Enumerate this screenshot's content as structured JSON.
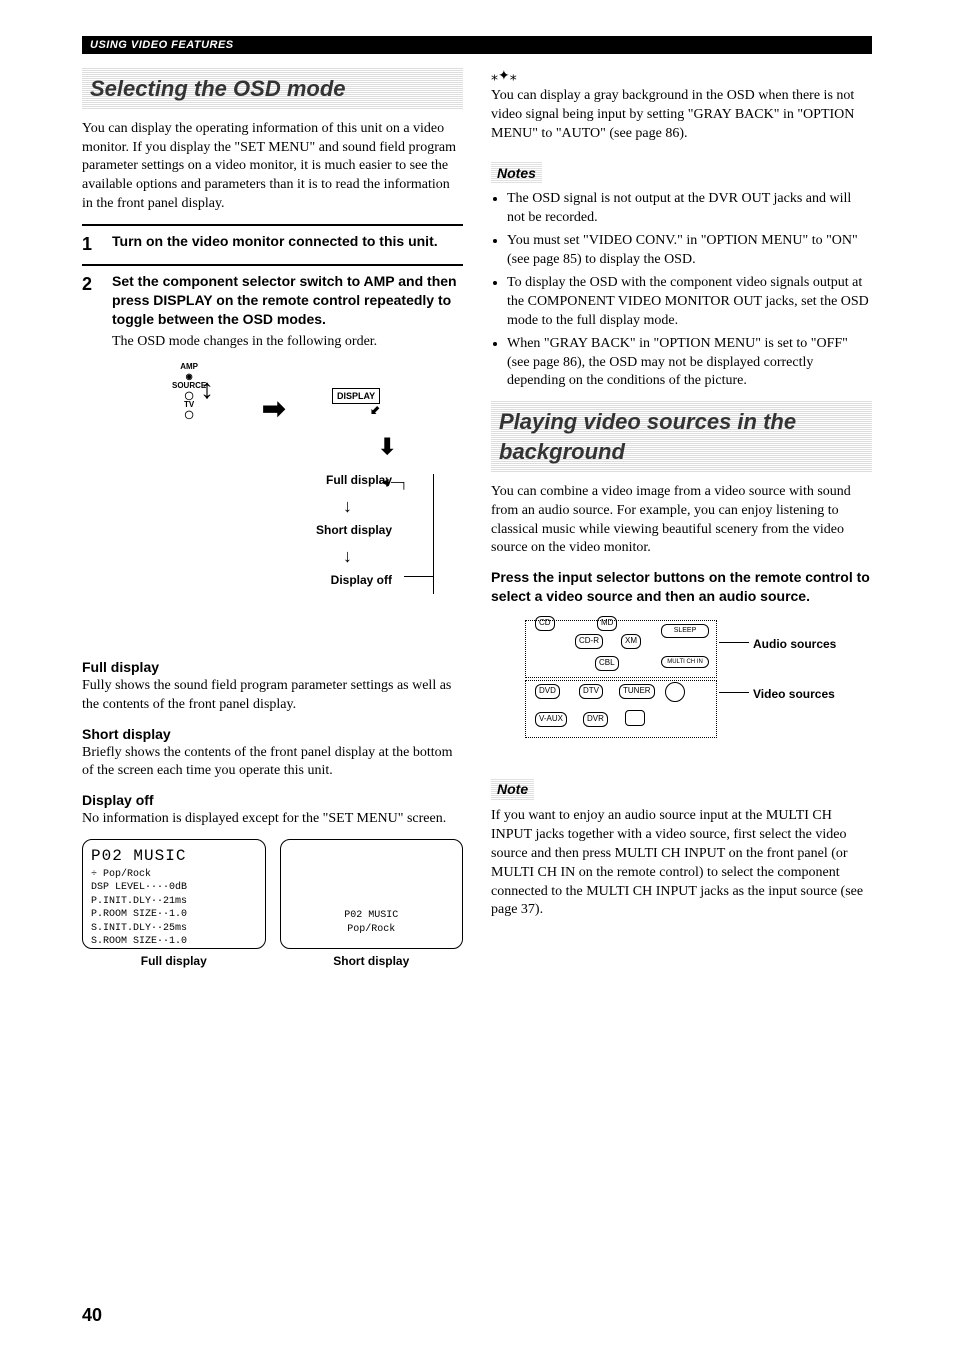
{
  "header": "USING VIDEO FEATURES",
  "pageNumber": "40",
  "left": {
    "sectionTitle": "Selecting the OSD mode",
    "intro": "You can display the operating information of this unit on a video monitor. If you display the \"SET MENU\" and sound field program parameter settings on a video monitor, it is much easier to see the available options and parameters than it is to read the information in the front panel display.",
    "step1": {
      "num": "1",
      "head": "Turn on the video monitor connected to this unit."
    },
    "step2": {
      "num": "2",
      "head": "Set the component selector switch to AMP and then press DISPLAY on the remote control repeatedly to toggle between the OSD modes.",
      "sub": "The OSD mode changes in the following order."
    },
    "diagram": {
      "amp": "AMP",
      "source": "SOURCE",
      "tv": "TV",
      "display": "DISPLAY",
      "full": "Full display",
      "short": "Short display",
      "off": "Display off"
    },
    "fullH": "Full display",
    "fullP": "Fully shows the sound field program parameter settings as well as the contents of the front panel display.",
    "shortH": "Short display",
    "shortP": "Briefly shows the contents of the front panel display at the bottom of the screen each time you operate this unit.",
    "offH": "Display off",
    "offP": "No information is displayed except for the \"SET MENU\" screen.",
    "screen1": {
      "line1": "P02      MUSIC",
      "line2": "÷       Pop/Rock",
      "line3": "    DSP LEVEL····0dB",
      "line4": "    P.INIT.DLY··21ms",
      "line5": "    P.ROOM SIZE··1.0",
      "line6": "    S.INIT.DLY··25ms",
      "line7": "    S.ROOM SIZE··1.0",
      "cap": "Full display"
    },
    "screen2": {
      "line1": "P02      MUSIC",
      "line2": "         Pop/Rock",
      "cap": "Short display"
    }
  },
  "right": {
    "tipP": "You can display a gray background in the OSD when there is not video signal being input by setting \"GRAY BACK\" in \"OPTION MENU\" to \"AUTO\" (see page 86).",
    "notesLabel": "Notes",
    "notes": [
      "The OSD signal is not output at the DVR OUT jacks and will not be recorded.",
      "You must set \"VIDEO CONV.\" in \"OPTION MENU\" to \"ON\" (see page 85) to display the OSD.",
      "To display the OSD with the component video signals output at the COMPONENT VIDEO MONITOR OUT jacks, set the OSD mode to the full display mode.",
      "When \"GRAY BACK\" in \"OPTION MENU\" is set to \"OFF\" (see page 86), the OSD may not be displayed correctly depending on the conditions of the picture."
    ],
    "sectionTitle": "Playing video sources in the background",
    "intro2": "You can combine a video image from a video source with sound from an audio source. For example, you can enjoy listening to classical music while viewing beautiful scenery from the video source on the video monitor.",
    "instr": "Press the input selector buttons on the remote control to select a video source and then an audio source.",
    "diagram": {
      "md": "MD",
      "cdr": "CD-R",
      "xm": "XM",
      "sleep": "SLEEP",
      "cd": "CD",
      "cbl": "CBL",
      "multichin": "MULTI CH IN",
      "dvd": "DVD",
      "dtv": "DTV",
      "tuner": "TUNER",
      "vaux": "V-AUX",
      "dvr": "DVR",
      "audio": "Audio sources",
      "video": "Video sources"
    },
    "noteLabel": "Note",
    "noteP": "If you want to enjoy an audio source input at the MULTI CH INPUT jacks together with a video source, first select the video source and then press MULTI CH INPUT on the front panel (or MULTI CH IN on the remote control) to select the component connected to the MULTI CH INPUT jacks as the input source (see page 37)."
  }
}
